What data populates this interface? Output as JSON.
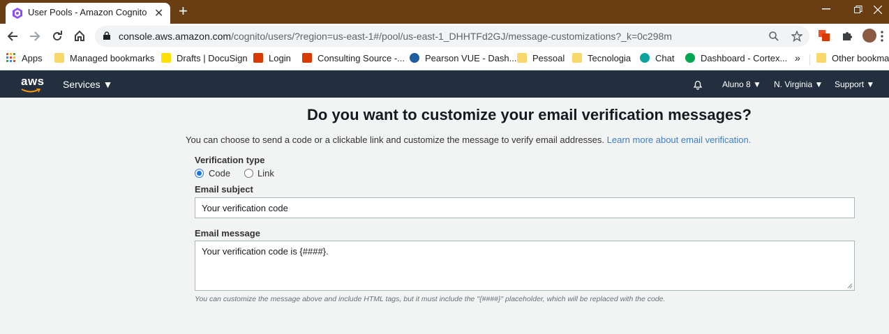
{
  "browser": {
    "tab_title": "User Pools - Amazon Cognito",
    "tab_close": "✕",
    "new_tab": "+",
    "url_domain": "console.aws.amazon.com",
    "url_path": "/cognito/users/?region=us-east-1#/pool/us-east-1_DHHTFd2GJ/message-customizations?_k=0c298m",
    "bookmarks": [
      {
        "label": "Apps",
        "icon": "apps-grid-icon",
        "color": "#ea4335"
      },
      {
        "label": "Managed bookmarks",
        "icon": "folder-icon",
        "color": "#f9d86b"
      },
      {
        "label": "Drafts | DocuSign",
        "icon": "docusign-icon",
        "color": "#ffe000"
      },
      {
        "label": "Login",
        "icon": "office-icon",
        "color": "#d83b01"
      },
      {
        "label": "Consulting Source -...",
        "icon": "office-icon",
        "color": "#d83b01"
      },
      {
        "label": "Pearson VUE - Dash...",
        "icon": "pearson-icon",
        "color": "#1c5e9e"
      },
      {
        "label": "Pessoal",
        "icon": "folder-icon",
        "color": "#f9d86b"
      },
      {
        "label": "Tecnologia",
        "icon": "folder-icon",
        "color": "#f9d86b"
      },
      {
        "label": "Chat",
        "icon": "chat-icon",
        "color": "#0aa39e"
      },
      {
        "label": "Dashboard - Cortex...",
        "icon": "cortex-icon",
        "color": "#00a651"
      }
    ],
    "overflow": "»",
    "other_bookmarks": "Other bookmarks"
  },
  "aws_nav": {
    "logo": "aws",
    "services": "Services ▼",
    "user": "Aluno 8 ▼",
    "region": "N. Virginia ▼",
    "support": "Support ▼"
  },
  "page": {
    "heading": "Do you want to customize your email verification messages?",
    "description": "You can choose to send a code or a clickable link and customize the message to verify email addresses.",
    "learn_more": "Learn more about email verification.",
    "verification_type_label": "Verification type",
    "verification_options": [
      "Code",
      "Link"
    ],
    "verification_selected": "Code",
    "email_subject_label": "Email subject",
    "email_subject_value": "Your verification code",
    "email_message_label": "Email message",
    "email_message_value": "Your verification code is {####}.",
    "hint": "You can customize the message above and include HTML tags, but it must include the \"{####}\" placeholder, which will be replaced with the code."
  }
}
